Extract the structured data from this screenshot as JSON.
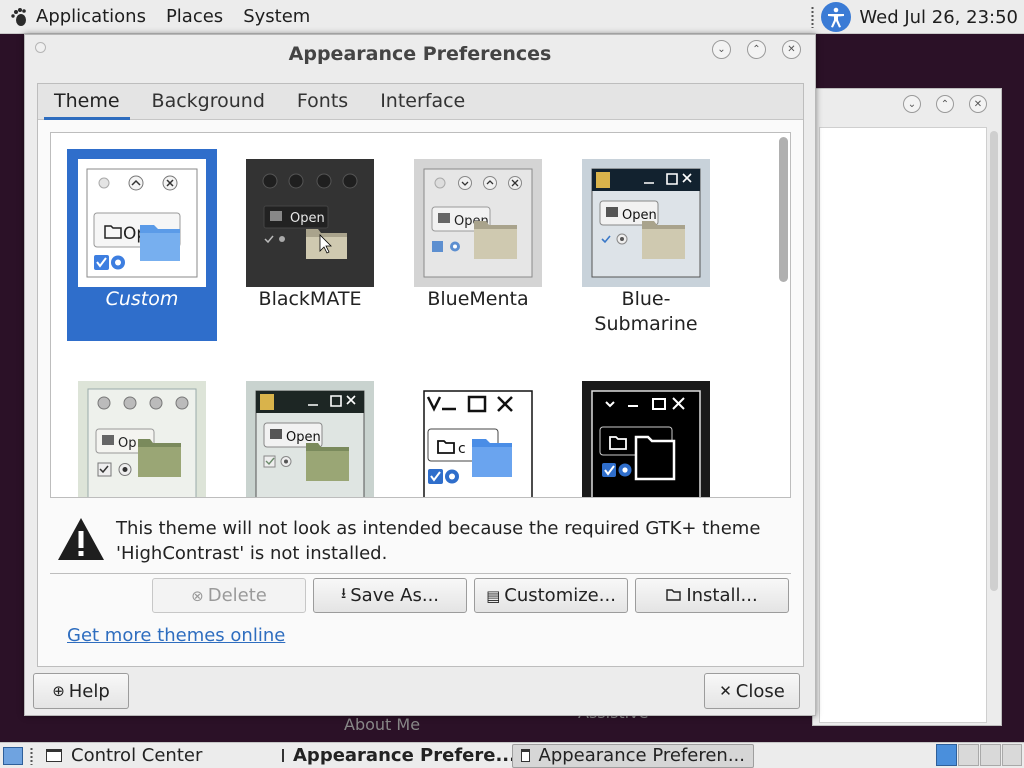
{
  "top_panel": {
    "menus": [
      "Applications",
      "Places",
      "System"
    ],
    "icons": {
      "foot": "gnome-foot-icon",
      "accessibility": "accessibility-icon"
    },
    "clock": "Wed Jul 26, 23:50"
  },
  "background_window": {
    "behind_text_1": "About Me",
    "behind_text_2": "Assistive"
  },
  "dialog": {
    "title": "Appearance Preferences",
    "tabs": [
      "Theme",
      "Background",
      "Fonts",
      "Interface"
    ],
    "active_tab": "Theme",
    "themes": [
      {
        "name": "Custom",
        "selected": true
      },
      {
        "name": "BlackMATE",
        "selected": false
      },
      {
        "name": "BlueMenta",
        "selected": false
      },
      {
        "name": "Blue-\nSubmarine",
        "selected": false
      },
      {
        "name": "",
        "selected": false
      },
      {
        "name": "",
        "selected": false
      },
      {
        "name": "",
        "selected": false
      },
      {
        "name": "",
        "selected": false
      }
    ],
    "preview_open_label": "Open",
    "preview_open_short": "Op",
    "warning": {
      "line1": "This theme will not look as intended because the required GTK+ theme",
      "line2": "'HighContrast' is not installed."
    },
    "buttons": {
      "delete": "Delete",
      "save_as": "Save As...",
      "customize": "Customize...",
      "install": "Install..."
    },
    "link": "Get more themes online",
    "help": "Help",
    "close": "Close"
  },
  "taskbar": {
    "tasks": [
      "Control Center",
      "Appearance Prefere...",
      "Appearance Preferen..."
    ]
  },
  "colors": {
    "accent": "#2f6ecb",
    "desktop": "#2b1127"
  }
}
